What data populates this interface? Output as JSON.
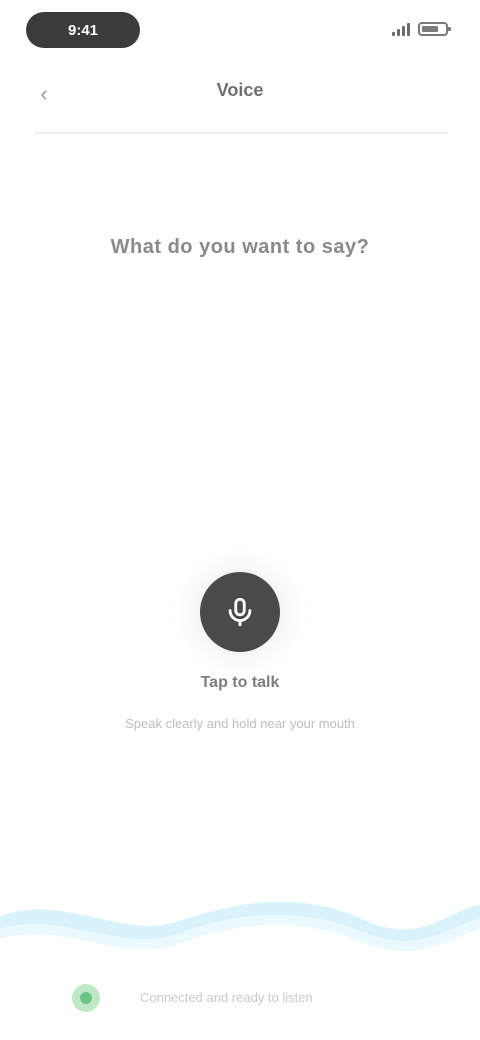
{
  "status_bar": {
    "time": "9:41",
    "icons": [
      "signal-icon",
      "battery-icon"
    ]
  },
  "header": {
    "back_icon": "back-icon",
    "title": "Voice"
  },
  "prompt": {
    "text": "What do you want to say?"
  },
  "mic": {
    "icon": "mic-icon",
    "label": "Tap to talk",
    "hint": "Speak clearly and hold near your mouth"
  },
  "bottom": {
    "icon": "status-dot-icon",
    "text": "Connected and ready to listen"
  },
  "colors": {
    "background": "#ffffff",
    "accent_green": "#6cc386",
    "wave": "#d8f3fb",
    "mic": "#4a4a4a"
  }
}
